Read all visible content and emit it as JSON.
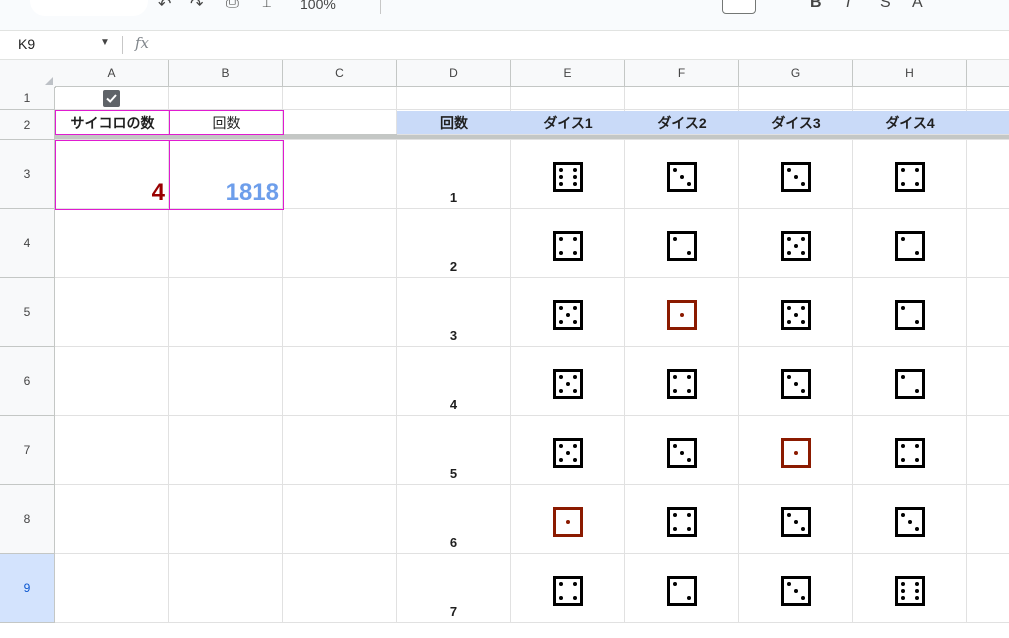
{
  "formula_bar": {
    "cell_ref": "K9",
    "fx_symbol": "fx"
  },
  "toolbar": {
    "zoom": "100%"
  },
  "columns": [
    "A",
    "B",
    "C",
    "D",
    "E",
    "F",
    "G",
    "H"
  ],
  "rows": [
    "1",
    "2",
    "3",
    "4",
    "5",
    "6",
    "7",
    "8",
    "9"
  ],
  "selected_row": "9",
  "headers": {
    "a2": "サイコロの数",
    "b2": "回数",
    "d2": "回数",
    "dice": [
      "ダイス1",
      "ダイス2",
      "ダイス3",
      "ダイス4"
    ]
  },
  "values": {
    "dice_count": "4",
    "roll_count": "1818"
  },
  "colors": {
    "dice_count": "#990000",
    "roll_count": "#6d9eeb",
    "header_fill": "#c9daf8",
    "highlight_border": "#e01bd0",
    "die_one": "#8b1a00"
  },
  "checkbox_checked": true,
  "rolls": [
    {
      "n": "1",
      "faces": [
        6,
        3,
        3,
        4
      ]
    },
    {
      "n": "2",
      "faces": [
        4,
        2,
        5,
        2
      ]
    },
    {
      "n": "3",
      "faces": [
        5,
        1,
        5,
        2
      ]
    },
    {
      "n": "4",
      "faces": [
        5,
        4,
        3,
        2
      ]
    },
    {
      "n": "5",
      "faces": [
        5,
        3,
        1,
        4
      ]
    },
    {
      "n": "6",
      "faces": [
        1,
        4,
        3,
        3
      ]
    },
    {
      "n": "7",
      "faces": [
        4,
        2,
        3,
        6
      ]
    }
  ]
}
